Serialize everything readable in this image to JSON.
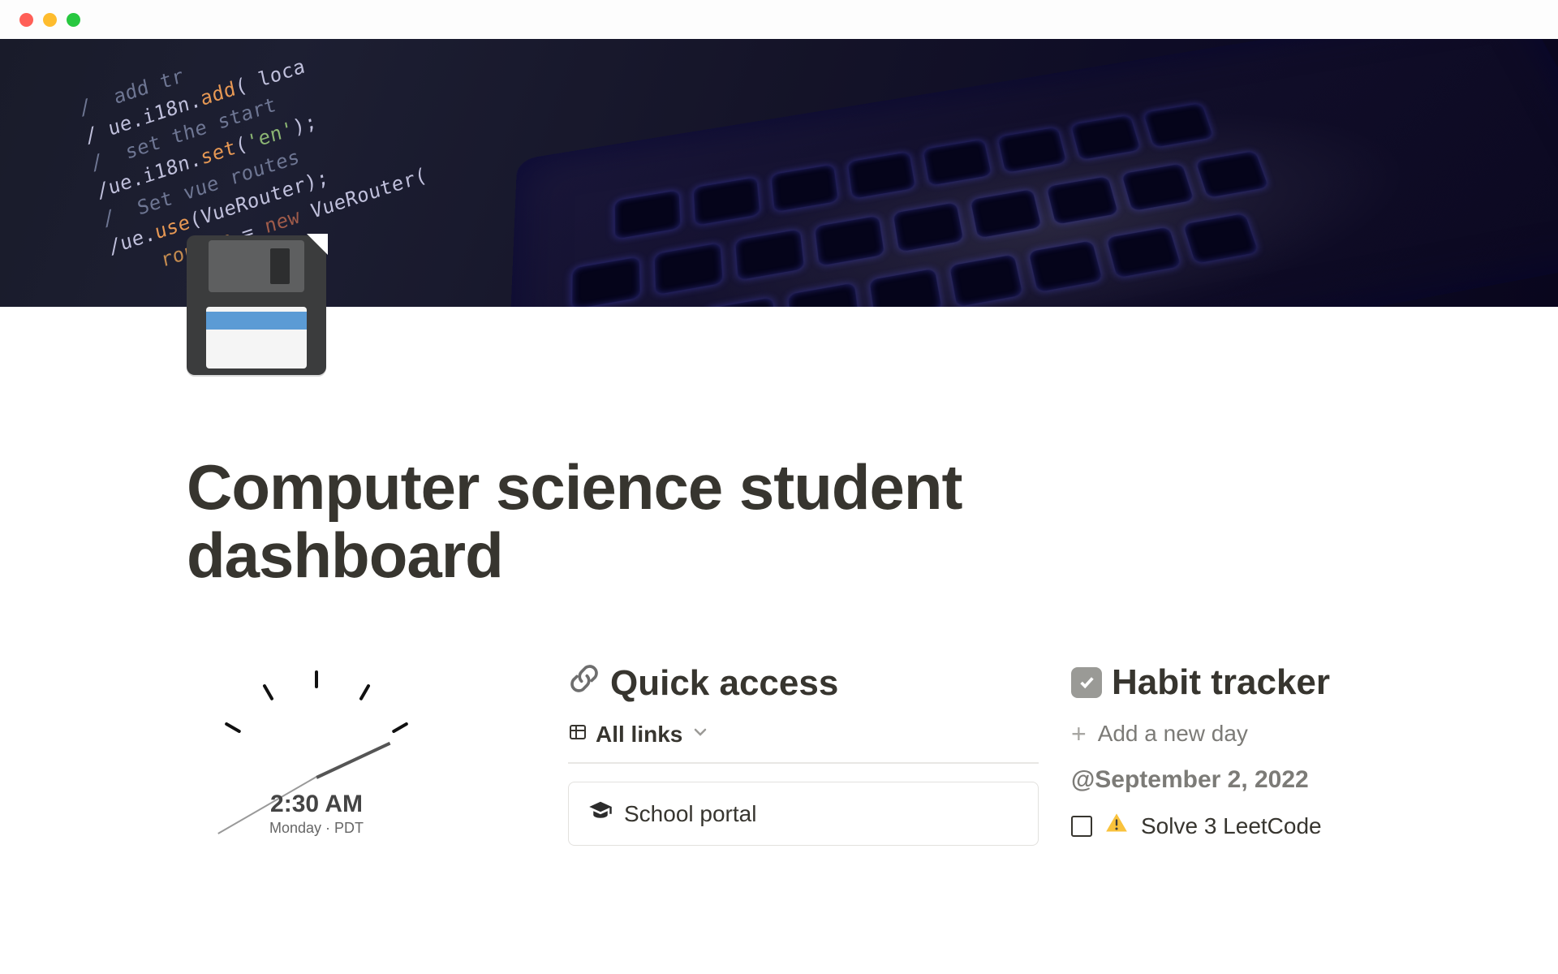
{
  "page": {
    "title": "Computer science student dashboard",
    "icon": "floppy-disk"
  },
  "cover_code": [
    {
      "cls": "c-comment",
      "text": "// add tr..."
    },
    {
      "cls": "c-prop",
      "text": "ue.i18n.add(..."
    },
    {
      "cls": "c-comment",
      "text": "// set the start loc..."
    },
    {
      "cls": "c-prop",
      "text": "ue.i18n.set('en');"
    },
    {
      "cls": "c-comment",
      "text": "// Set vue routes"
    },
    {
      "cls": "c-prop",
      "text": "ue.use(VueRouter);"
    },
    {
      "cls": "c-key",
      "text": "const router = new VueRouter({"
    }
  ],
  "clock": {
    "time": "2:30 AM",
    "subline": "Monday · PDT"
  },
  "quick_access": {
    "icon": "link-icon",
    "heading": "Quick access",
    "view": {
      "icon": "table-icon",
      "label": "All links"
    },
    "card": {
      "icon": "graduation-cap-icon",
      "label": "School portal"
    }
  },
  "habit_tracker": {
    "icon": "checkbox-icon",
    "heading": "Habit tracker",
    "add_label": "Add a new day",
    "date": "@September 2, 2022",
    "todo": {
      "icon": "warning-icon",
      "label": "Solve 3 LeetCode"
    }
  }
}
